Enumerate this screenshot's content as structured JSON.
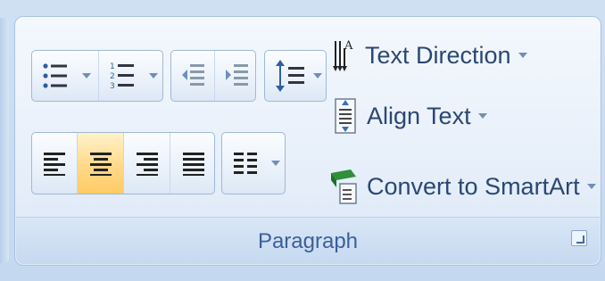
{
  "ribbon_group": {
    "title": "Paragraph"
  },
  "icons": {
    "bullets": "bullets-icon",
    "numbering": "numbering-icon",
    "decrease_indent": "decrease-indent-icon",
    "increase_indent": "increase-indent-icon",
    "line_spacing": "line-spacing-icon",
    "align_left": "align-left-icon",
    "center": "center-align-icon",
    "align_right": "align-right-icon",
    "justify": "justify-icon",
    "columns": "columns-icon",
    "text_direction": "text-direction-icon",
    "align_text": "align-text-icon",
    "smartart": "convert-smartart-icon",
    "launcher": "dialog-launcher-icon"
  },
  "commands": {
    "text_direction": "Text Direction",
    "align_text": "Align Text",
    "convert_smartart": "Convert to SmartArt"
  },
  "state": {
    "selected_alignment": "center"
  },
  "colors": {
    "ribbon_text": "#2b4773",
    "selected_highlight": "#ffd98a"
  }
}
